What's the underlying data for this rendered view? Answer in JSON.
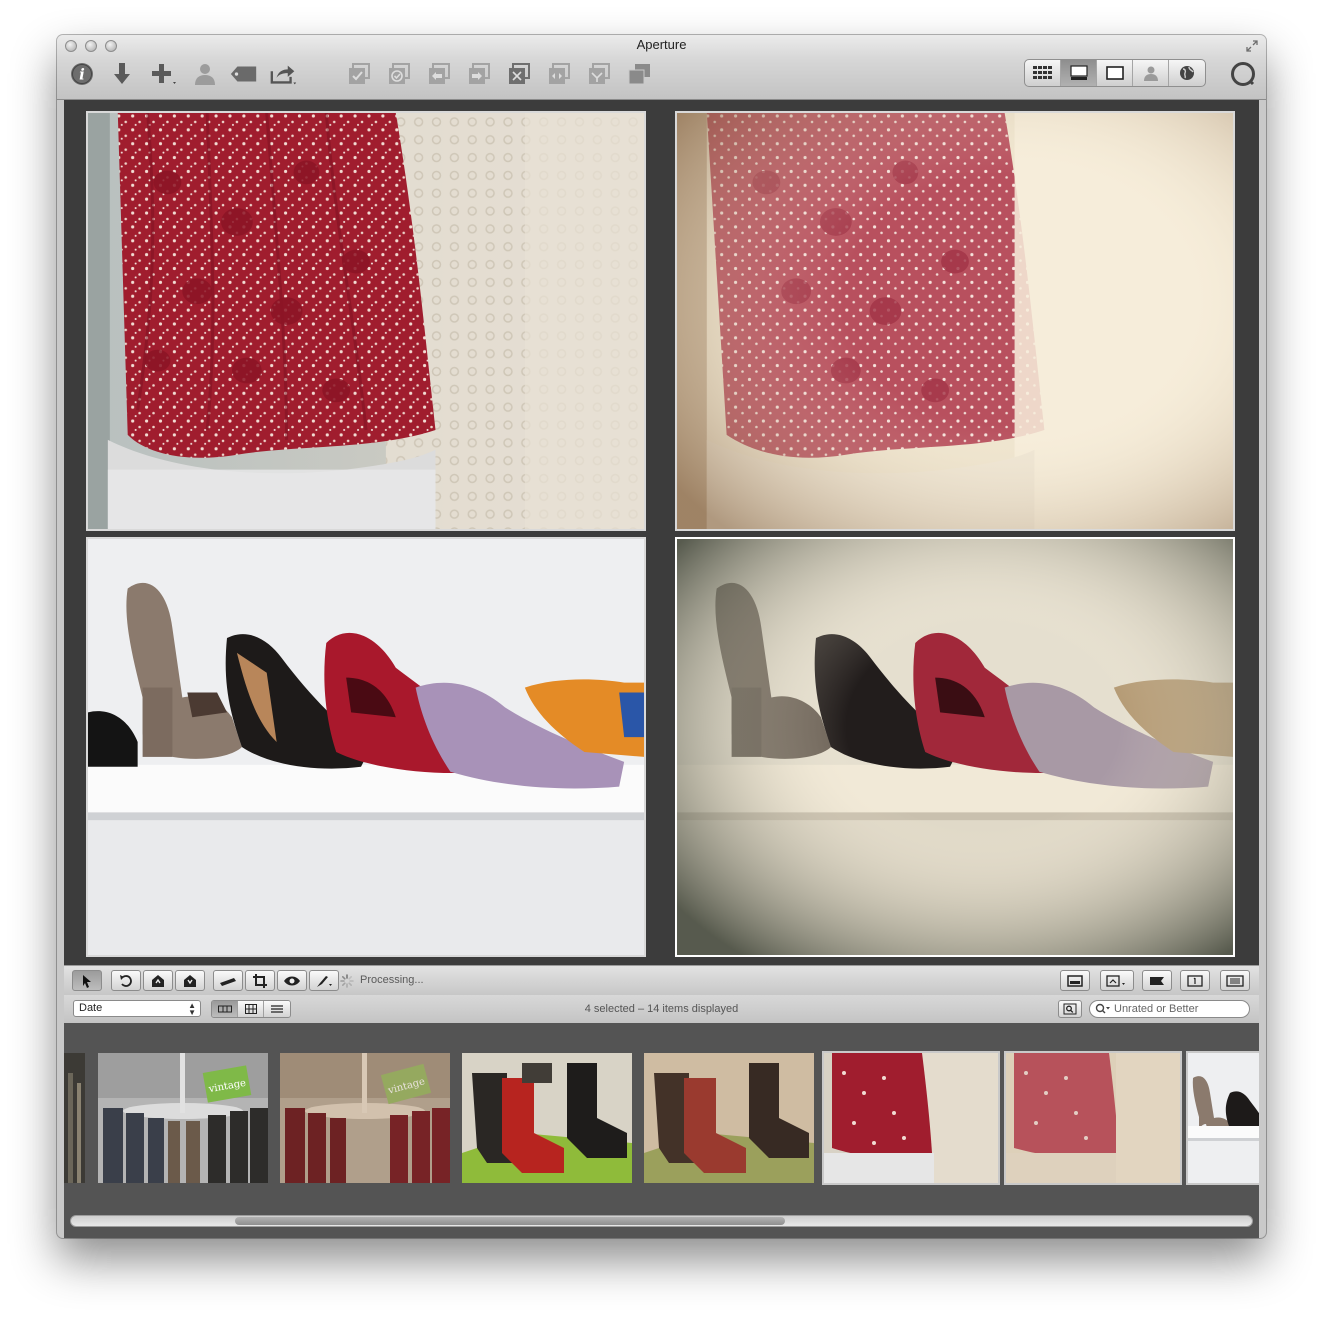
{
  "window": {
    "title": "Aperture"
  },
  "toolbar": {
    "left_buttons": [
      "inspector-button",
      "import-button",
      "new-button",
      "faces-button",
      "keywords-button",
      "share-button"
    ],
    "center_buttons": [
      "stack-button",
      "pick-button",
      "previous-button",
      "next-button",
      "extract-button",
      "compare-button",
      "promote-button",
      "split-button"
    ],
    "view_modes": [
      "browser",
      "split-view",
      "viewer",
      "faces",
      "places"
    ],
    "active_view_mode": "split-view"
  },
  "controls": {
    "processing_text": "Processing...",
    "tools": [
      "select-tool",
      "rotate-left-tool",
      "rotate-right-tool",
      "lift-tool",
      "stamp-tool",
      "straighten-tool",
      "crop-tool",
      "red-eye-tool",
      "brush-tool"
    ]
  },
  "browser": {
    "sort_label": "Date",
    "status": "4 selected – 14 items displayed",
    "filter_placeholder": "Unrated or Better"
  },
  "viewer": {
    "photos": [
      {
        "name": "red-dress-original",
        "subject": "red floral dress on rack",
        "selected": false
      },
      {
        "name": "red-dress-vintage",
        "subject": "red floral dress, vintage effect",
        "selected": false
      },
      {
        "name": "shoes-original",
        "subject": "row of shoes on shelf",
        "selected": false
      },
      {
        "name": "shoes-vintage",
        "subject": "row of shoes, vintage effect",
        "selected": true
      }
    ]
  },
  "filmstrip": {
    "items": [
      {
        "name": "partial-left",
        "selected": false
      },
      {
        "name": "clothing-rack-vintage-sign",
        "sign_text": "vintage",
        "selected": false
      },
      {
        "name": "clothing-rack-vintage-sign-edited",
        "sign_text": "vintage",
        "selected": false
      },
      {
        "name": "cowboy-boots",
        "selected": false
      },
      {
        "name": "cowboy-boots-edited",
        "selected": false
      },
      {
        "name": "red-dress",
        "selected": true
      },
      {
        "name": "red-dress-edited",
        "selected": true
      },
      {
        "name": "shoes-partial",
        "selected": true
      }
    ]
  },
  "colors": {
    "window_chrome": "#c9c9c9",
    "viewer_bg": "#3c3c3c",
    "filmstrip_bg": "#545454",
    "selection_border": "#ffffff"
  }
}
